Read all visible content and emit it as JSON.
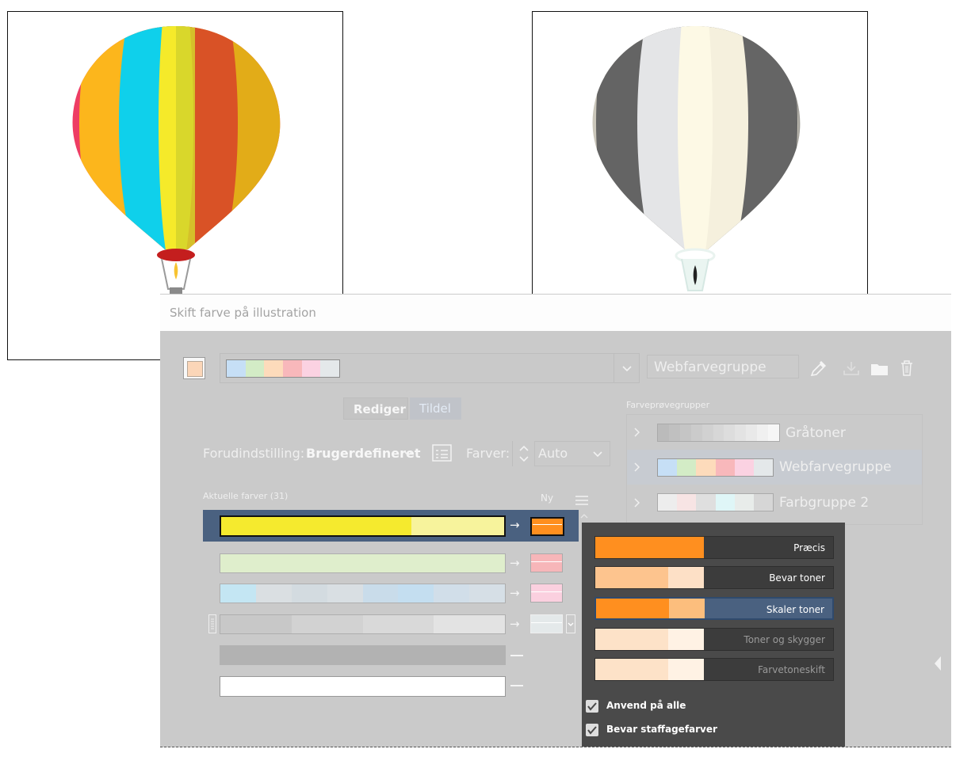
{
  "dialog": {
    "title": "Skift farve på illustration",
    "group_name": "Webfarvegruppe",
    "tabs": [
      {
        "label": "Rediger"
      },
      {
        "label": "Tildel"
      }
    ],
    "preset_label": "Forudindstilling:",
    "preset_value": "Brugerdefineret",
    "colors_label": "Farver:",
    "colors_value": "Auto",
    "current_colors_label": "Aktuelle farver (31)",
    "new_label": "Ny",
    "swatch_groups_label": "Farveprøvegrupper",
    "swatch_groups": [
      {
        "name": "Gråtoner"
      },
      {
        "name": "Webfarvegruppe"
      },
      {
        "name": "Farbgruppe 2"
      }
    ],
    "top_strip_colors": [
      "#c6dff6",
      "#d3ecc6",
      "#fddbbb",
      "#f8b8bb",
      "#fbd2e2",
      "#e4e8ea"
    ]
  },
  "recolor_menu": {
    "options": [
      {
        "label": "Præcis"
      },
      {
        "label": "Bevar toner"
      },
      {
        "label": "Skaler toner"
      },
      {
        "label": "Toner og skygger"
      },
      {
        "label": "Farvetoneskift"
      }
    ],
    "checkboxes": [
      {
        "label": "Anvend på alle",
        "checked": true
      },
      {
        "label": "Bevar staffagefarver",
        "checked": true
      }
    ]
  },
  "colors": {
    "accent": "#4a6180",
    "menu_bg": "#4a4a4a",
    "orange": "#ff8f1f"
  }
}
